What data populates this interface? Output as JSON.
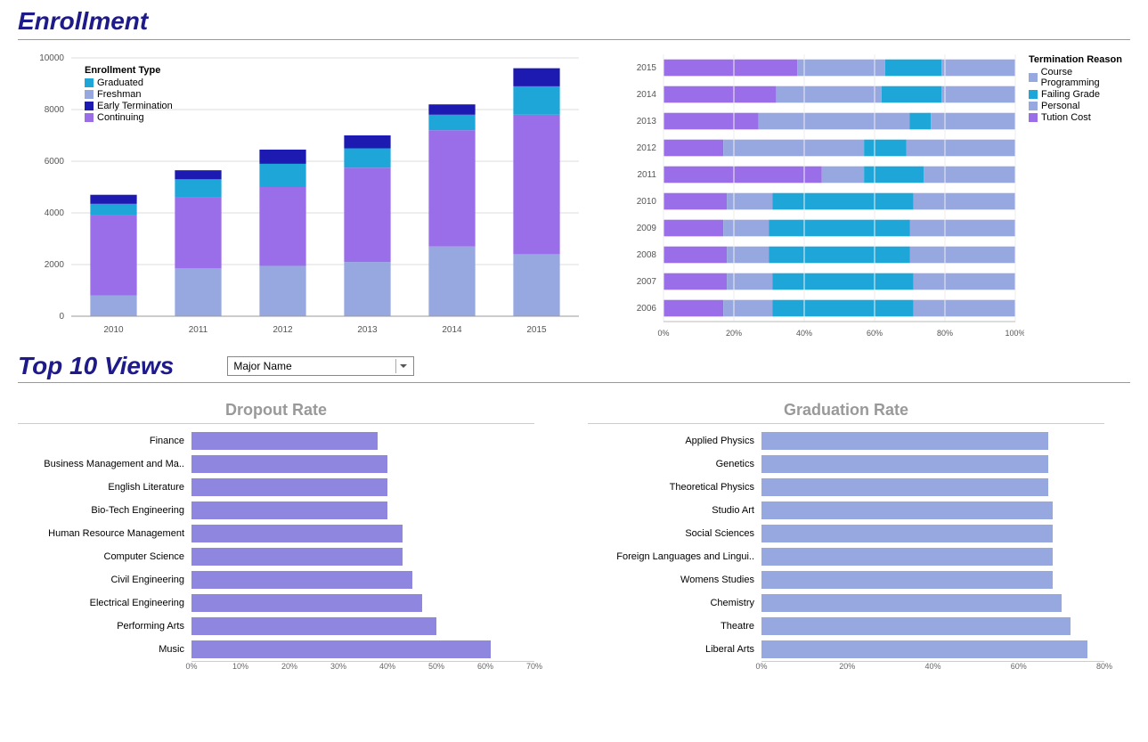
{
  "titles": {
    "enrollment": "Enrollment",
    "top10": "Top 10 Views",
    "dropout": "Dropout Rate",
    "graduation": "Graduation Rate"
  },
  "dropdown": {
    "selected": "Major Name"
  },
  "enrollment_legend": {
    "title": "Enrollment Type",
    "items": [
      {
        "label": "Graduated",
        "color": "#1ea6d9"
      },
      {
        "label": "Freshman",
        "color": "#97a7e0"
      },
      {
        "label": "Early Termination",
        "color": "#1c1ab0"
      },
      {
        "label": "Continuing",
        "color": "#9a6ee8"
      }
    ]
  },
  "termination_legend": {
    "title": "Termination Reason",
    "items": [
      {
        "label": "Course Programming",
        "color": "#97a7e0"
      },
      {
        "label": "Failing Grade",
        "color": "#1ea6d9"
      },
      {
        "label": "Personal",
        "color": "#97a7e0"
      },
      {
        "label": "Tution Cost",
        "color": "#9a6ee8"
      }
    ]
  },
  "chart_data": [
    {
      "id": "enrollment-stacked",
      "type": "bar-stacked",
      "categories": [
        "2010",
        "2011",
        "2012",
        "2013",
        "2014",
        "2015"
      ],
      "series": [
        {
          "name": "Freshman",
          "color": "#97a7e0",
          "values": [
            800,
            1850,
            1950,
            2100,
            2700,
            2400
          ]
        },
        {
          "name": "Continuing",
          "color": "#9a6ee8",
          "values": [
            3100,
            2750,
            3050,
            3650,
            4500,
            5400
          ]
        },
        {
          "name": "Graduated",
          "color": "#1ea6d9",
          "values": [
            450,
            700,
            900,
            750,
            600,
            1100
          ]
        },
        {
          "name": "Early Termination",
          "color": "#1c1ab0",
          "values": [
            350,
            350,
            550,
            500,
            400,
            700
          ]
        }
      ],
      "ylim": [
        0,
        10000
      ],
      "yticks": [
        0,
        2000,
        4000,
        6000,
        8000,
        10000
      ]
    },
    {
      "id": "termination-100pct",
      "type": "bar-stacked-100",
      "categories": [
        "2015",
        "2014",
        "2013",
        "2012",
        "2011",
        "2010",
        "2009",
        "2008",
        "2007",
        "2006"
      ],
      "series": [
        {
          "name": "Tution Cost",
          "color": "#9a6ee8",
          "values": [
            38,
            32,
            27,
            17,
            45,
            18,
            17,
            18,
            18,
            17
          ]
        },
        {
          "name": "Personal",
          "color": "#97a7e0",
          "values": [
            25,
            30,
            43,
            40,
            12,
            13,
            13,
            12,
            13,
            14
          ]
        },
        {
          "name": "Failing Grade",
          "color": "#1ea6d9",
          "values": [
            16,
            17,
            6,
            12,
            17,
            40,
            40,
            40,
            40,
            40
          ]
        },
        {
          "name": "Course Programming",
          "color": "#97a7e0",
          "values": [
            21,
            21,
            24,
            31,
            26,
            29,
            30,
            30,
            29,
            29
          ]
        }
      ],
      "xticks": [
        "0%",
        "20%",
        "40%",
        "60%",
        "80%",
        "100%"
      ]
    },
    {
      "id": "dropout-rate",
      "type": "bar-horizontal",
      "color": "#8f86e0",
      "xlim": 70,
      "xticks": [
        "0%",
        "10%",
        "20%",
        "30%",
        "40%",
        "50%",
        "60%",
        "70%"
      ],
      "items": [
        {
          "label": "Finance",
          "value": 38
        },
        {
          "label": "Business Management and Ma..",
          "value": 40
        },
        {
          "label": "English Literature",
          "value": 40
        },
        {
          "label": "Bio-Tech Engineering",
          "value": 40
        },
        {
          "label": "Human Resource Management",
          "value": 43
        },
        {
          "label": "Computer Science",
          "value": 43
        },
        {
          "label": "Civil Engineering",
          "value": 45
        },
        {
          "label": "Electrical Engineering",
          "value": 47
        },
        {
          "label": "Performing Arts",
          "value": 50
        },
        {
          "label": "Music",
          "value": 61
        }
      ]
    },
    {
      "id": "graduation-rate",
      "type": "bar-horizontal",
      "color": "#97a7e0",
      "xlim": 80,
      "xticks": [
        "0%",
        "20%",
        "40%",
        "60%",
        "80%"
      ],
      "items": [
        {
          "label": "Applied Physics",
          "value": 67
        },
        {
          "label": "Genetics",
          "value": 67
        },
        {
          "label": "Theoretical Physics",
          "value": 67
        },
        {
          "label": "Studio Art",
          "value": 68
        },
        {
          "label": "Social Sciences",
          "value": 68
        },
        {
          "label": "Foreign Languages and Lingui..",
          "value": 68
        },
        {
          "label": "Womens Studies",
          "value": 68
        },
        {
          "label": "Chemistry",
          "value": 70
        },
        {
          "label": "Theatre",
          "value": 72
        },
        {
          "label": "Liberal Arts",
          "value": 76
        }
      ]
    }
  ]
}
